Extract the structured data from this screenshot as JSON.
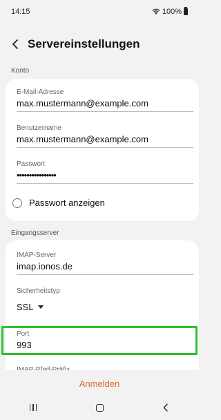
{
  "status": {
    "time": "14:15",
    "battery": "100%"
  },
  "header": {
    "title": "Servereinstellungen"
  },
  "account": {
    "section_label": "Konto",
    "email_label": "E-Mail-Adresse",
    "email_value": "max.mustermann@example.com",
    "username_label": "Benutzername",
    "username_value": "max.mustermann@example.com",
    "password_label": "Passwort",
    "password_value": "••••••••••••••••",
    "show_password_label": "Passwort anzeigen"
  },
  "incoming": {
    "section_label": "Eingangsserver",
    "imap_server_label": "IMAP-Server",
    "imap_server_value": "imap.ionos.de",
    "security_label": "Sicherheitstyp",
    "security_value": "SSL",
    "port_label": "Port",
    "port_value": "993",
    "imap_path_label": "IMAP-Pfad-Präfix"
  },
  "footer": {
    "action_label": "Anmelden"
  },
  "colors": {
    "accent": "#d9662a",
    "highlight": "#2ec12e",
    "background": "#f2f2f2"
  },
  "icons": {
    "back": "chevron-left-icon",
    "wifi": "wifi-icon",
    "battery": "battery-icon"
  }
}
